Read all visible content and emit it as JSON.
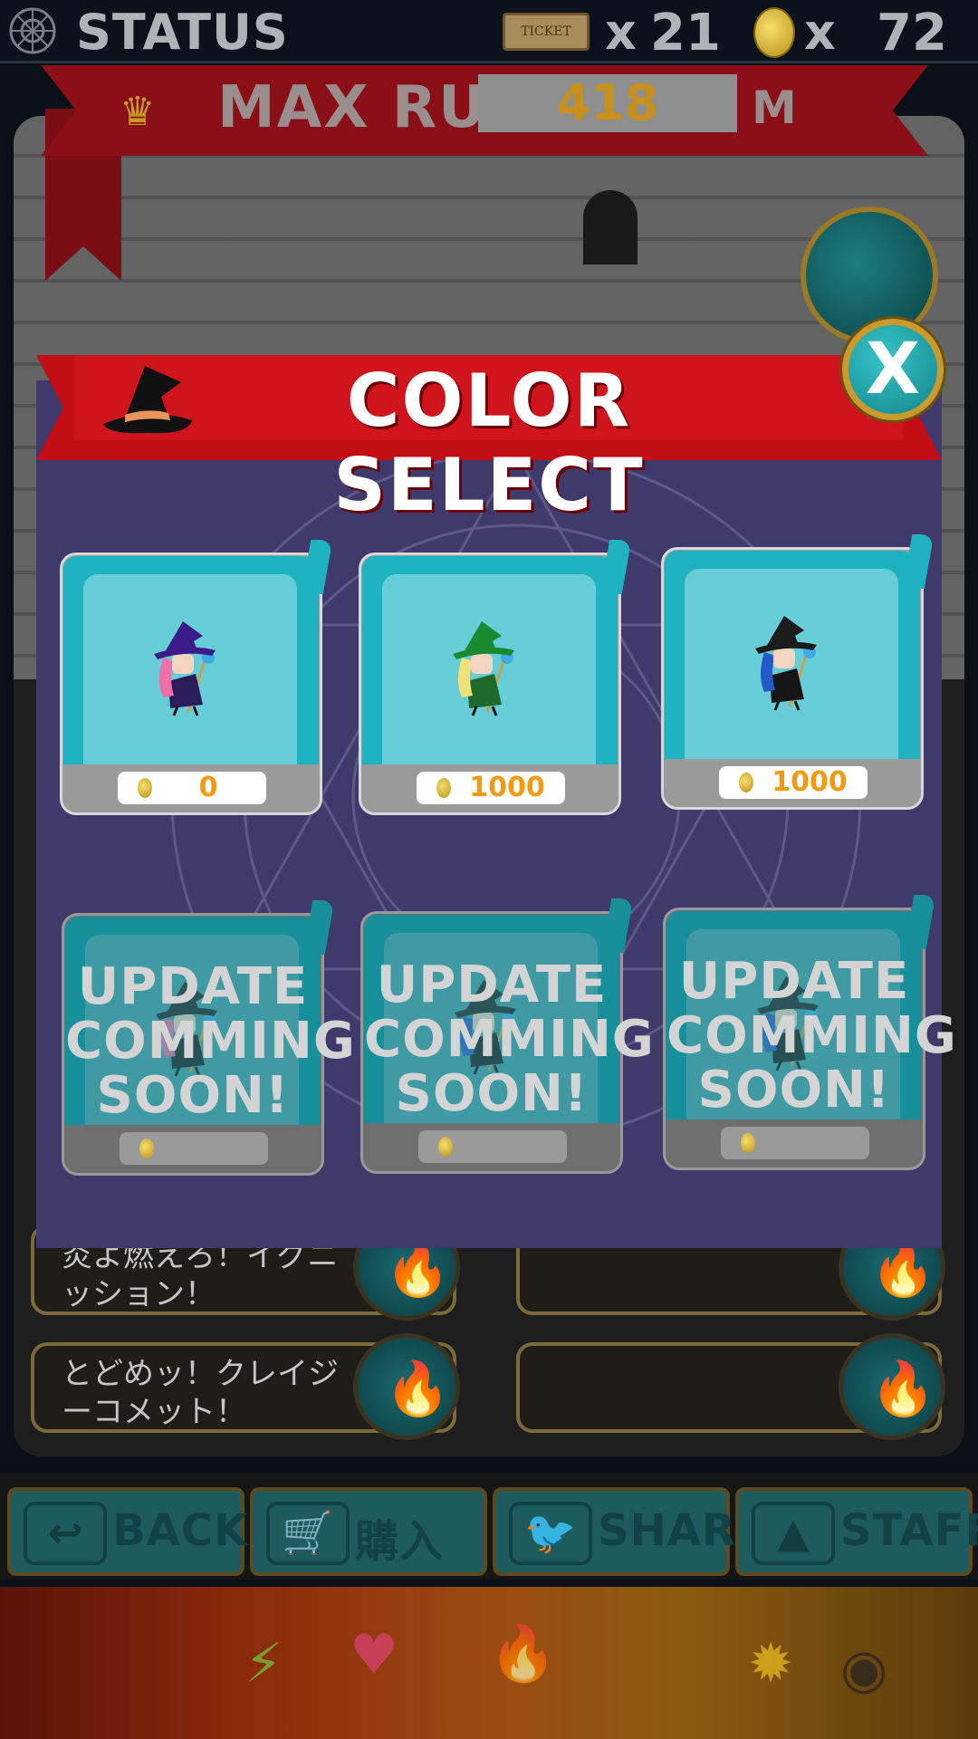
{
  "topbar": {
    "status_label": "STATUS",
    "ticket_label": "TICKET",
    "ticket_x": "x",
    "ticket_count": "21",
    "coin_x": "x",
    "coin_count": "72"
  },
  "max_run": {
    "label": "MAX RUN",
    "value": "418",
    "unit": "M"
  },
  "dialog": {
    "title": "COLOR SELECT",
    "close_label": "X",
    "cards": [
      {
        "price": "0",
        "locked": false,
        "hat": "#3b1b8a",
        "hair": "#ef6fa8",
        "robe": "#2a1b5a"
      },
      {
        "price": "1000",
        "locked": false,
        "hat": "#1a8a30",
        "hair": "#f0e07a",
        "robe": "#1d6a2a"
      },
      {
        "price": "1000",
        "locked": false,
        "hat": "#1c1c1c",
        "hair": "#2459c9",
        "robe": "#151515"
      },
      {
        "price": "",
        "locked": true,
        "locked_text": "UPDATE COMMING SOON!",
        "hat": "#1c1c1c",
        "hair": "#ef6fa8",
        "robe": "#151515"
      },
      {
        "price": "",
        "locked": true,
        "locked_text": "UPDATE COMMING SOON!",
        "hat": "#1c1c1c",
        "hair": "#2459c9",
        "robe": "#151515"
      },
      {
        "price": "",
        "locked": true,
        "locked_text": "UPDATE COMMING SOON!",
        "hat": "#1c1c1c",
        "hair": "#2459c9",
        "robe": "#151515"
      }
    ]
  },
  "skills": [
    {
      "text": "炎よ燃えろ！イグニッション！"
    },
    {
      "text": ""
    },
    {
      "text": "とどめッ！クレイジーコメット！"
    },
    {
      "text": ""
    }
  ],
  "buttons": {
    "back": "BACK",
    "buy": "購入",
    "share": "SHARE",
    "staff": "STAFF"
  },
  "colors": {
    "dialog_bg": "#3f3a6b",
    "ribbon": "#c20d15",
    "card_teal": "#1fb3c2",
    "price_text": "#f39a10",
    "button_teal": "#1d5b5e"
  }
}
